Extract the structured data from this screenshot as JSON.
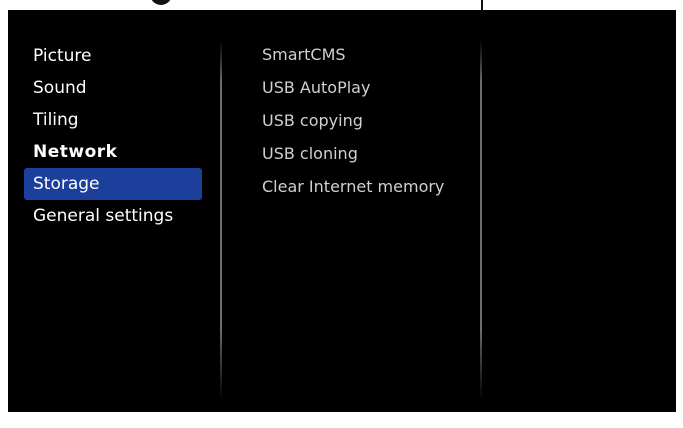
{
  "main_menu": {
    "items": [
      {
        "label": "Picture",
        "selected": false,
        "bold": false
      },
      {
        "label": "Sound",
        "selected": false,
        "bold": false
      },
      {
        "label": "Tiling",
        "selected": false,
        "bold": false
      },
      {
        "label": "Network",
        "selected": false,
        "bold": true
      },
      {
        "label": "Storage",
        "selected": true,
        "bold": false
      },
      {
        "label": "General settings",
        "selected": false,
        "bold": false
      }
    ]
  },
  "submenu": {
    "items": [
      {
        "label": "SmartCMS"
      },
      {
        "label": "USB AutoPlay"
      },
      {
        "label": "USB copying"
      },
      {
        "label": "USB cloning"
      },
      {
        "label": "Clear Internet memory"
      }
    ]
  },
  "colors": {
    "background": "#000000",
    "selection": "#1c3f9c",
    "text_primary": "#ffffff",
    "text_secondary": "#d0d0d0"
  }
}
